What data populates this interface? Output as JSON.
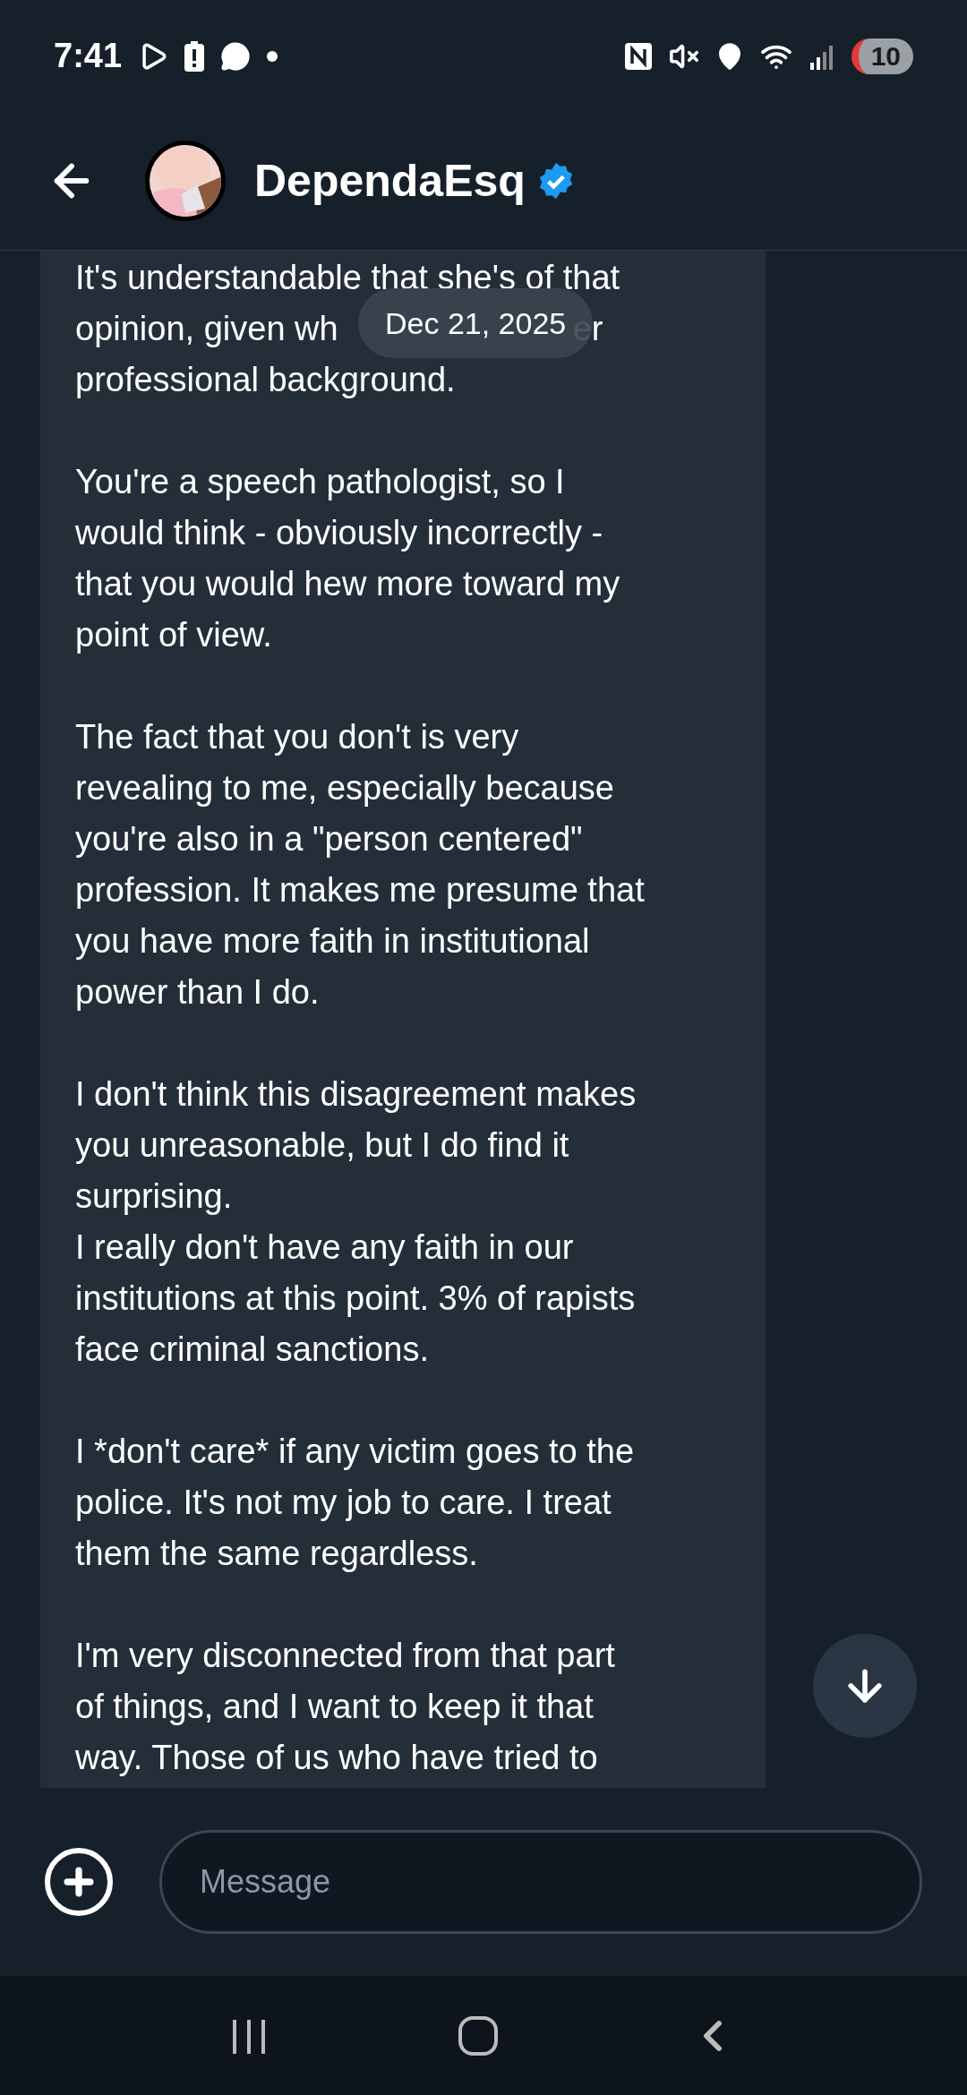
{
  "status_bar": {
    "time": "7:41",
    "battery": "10"
  },
  "header": {
    "name": "DependaEsq",
    "verified": true
  },
  "date_chip": "Dec 21, 2025",
  "message": {
    "paragraphs": [
      [
        "It's understandable that she's of that",
        [
          "opinion, given wh",
          "er"
        ],
        "professional background."
      ],
      [
        "You're a speech pathologist, so I",
        "would think - obviously incorrectly -",
        "that you would hew more toward my",
        "point of view."
      ],
      [
        "The fact that you don't is very",
        "revealing to me, especially because",
        "you're also in a \"person centered\"",
        "profession. It makes me presume that",
        "you have more faith in institutional",
        "power than I do."
      ],
      [
        "I don't think this disagreement makes",
        "you unreasonable, but I do find it",
        "surprising.",
        "I really don't have any faith in our",
        "institutions at this point. 3% of rapists",
        "face criminal sanctions."
      ],
      [
        "I *don't care* if any victim goes to the",
        "police. It's not my job to care. I treat",
        "them the same regardless."
      ],
      [
        "I'm very disconnected from that part",
        "of things, and I want to keep it that",
        "way. Those of us who have tried to"
      ]
    ]
  },
  "composer": {
    "placeholder": "Message"
  }
}
